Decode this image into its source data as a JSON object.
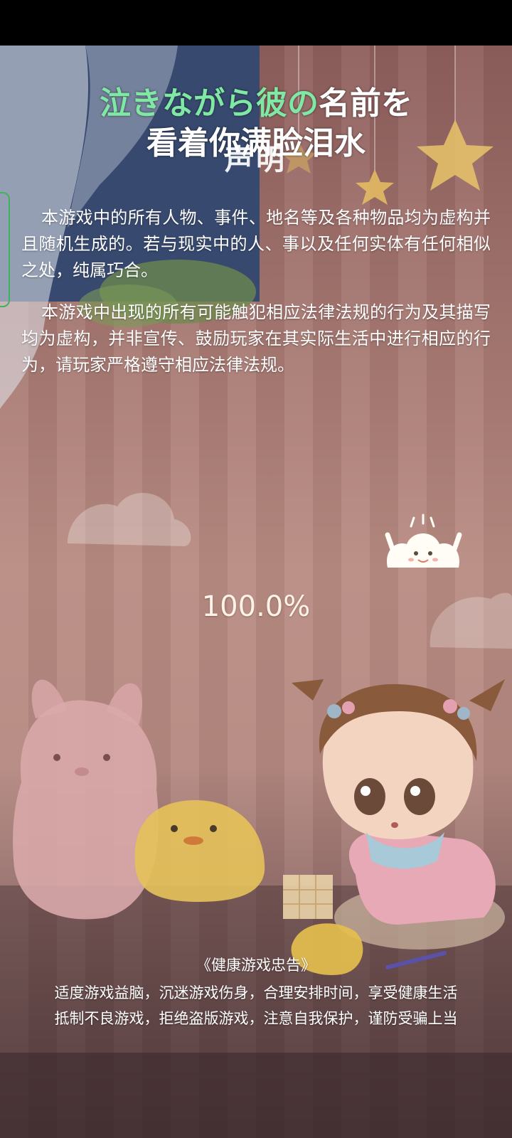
{
  "title": {
    "line1_highlight": "泣きながら彼の",
    "line1_rest": "名前を",
    "line2": "看着你满脸泪水"
  },
  "disclaimer": {
    "heading": "声明",
    "paragraphs": [
      "本游戏中的所有人物、事件、地名等及各种物品均为虚构并且随机生成的。若与现实中的人、事以及任何实体有任何相似之处，纯属巧合。",
      "本游戏中出现的所有可能触犯相应法律法规的行为及其描写均为虚构，并非宣传、鼓励玩家在其实际生活中进行相应的行为，请玩家严格遵守相应法律法规。"
    ]
  },
  "loading": {
    "progress_text": "100.0%",
    "progress_fraction": 1.0
  },
  "health_notice": {
    "title": "《健康游戏忠告》",
    "lines": [
      "适度游戏益脑，沉迷游戏伤身，合理安排时间，享受健康生活",
      "抵制不良游戏，拒绝盗版游戏，注意自我保护，谨防受骗上当"
    ]
  },
  "colors": {
    "title_highlight": "#7fe8a4",
    "title_text": "#ffffff",
    "side_tab_border": "#3fb35c"
  },
  "icons": {
    "mascot": "cloud-mascot-icon"
  }
}
